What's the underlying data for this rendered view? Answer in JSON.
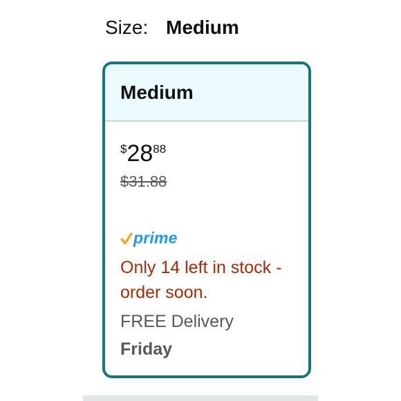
{
  "size_selector": {
    "label": "Size:",
    "selected_value": "Medium"
  },
  "variant_card": {
    "title": "Medium",
    "price": {
      "symbol": "$",
      "whole": "28",
      "fraction": "88"
    },
    "list_price": "$31.88",
    "prime": {
      "icon": "check-icon",
      "label": "prime"
    },
    "stock_message": "Only 14 left in stock - order soon.",
    "delivery_text": "FREE Delivery",
    "delivery_day": "Friday"
  },
  "colors": {
    "card_border": "#127681",
    "card_header_bg": "#ebfbfd",
    "stock_text": "#b12704",
    "prime_blue": "#1a98ff",
    "prime_check": "#f7a21b",
    "secondary_text": "#565959"
  }
}
